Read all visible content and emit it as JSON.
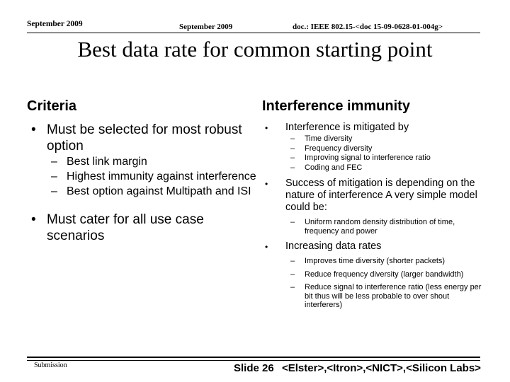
{
  "header": {
    "date_outer": "September 2009",
    "date_inner": "September 2009",
    "doc_reference": "doc.: IEEE 802.15-<doc 15-09-0628-01-004g>"
  },
  "title": "Best data rate for common starting point",
  "bullet_glyph": "•",
  "dash_glyph": "–",
  "columns": {
    "left": {
      "heading": "Criteria",
      "items": [
        {
          "level": 1,
          "text": "Must be selected for most robust option"
        },
        {
          "level": 2,
          "text": "Best link margin"
        },
        {
          "level": 2,
          "text": "Highest immunity against interference"
        },
        {
          "level": 2,
          "text": "Best option against Multipath and ISI"
        },
        {
          "level": 1,
          "text": "Must cater for all use case scenarios"
        }
      ]
    },
    "right": {
      "heading": "Interference immunity",
      "items": [
        {
          "level": 1,
          "text": "Interference is mitigated by"
        },
        {
          "level": 2,
          "text": "Time diversity"
        },
        {
          "level": 2,
          "text": "Frequency diversity"
        },
        {
          "level": 2,
          "text": "Improving signal to interference ratio"
        },
        {
          "level": 2,
          "text": "Coding and FEC"
        },
        {
          "level": 1,
          "text": "Success of mitigation is depending on the nature of interference A very simple model could be:"
        },
        {
          "level": 2,
          "text": "Uniform random density distribution of time, frequency and power"
        },
        {
          "level": 1,
          "text": "Increasing data rates"
        },
        {
          "level": 2,
          "text": "Improves time diversity (shorter packets)"
        },
        {
          "level": 2,
          "text": "Reduce frequency diversity (larger bandwidth)"
        },
        {
          "level": 2,
          "text": "Reduce signal to interference ratio (less energy per bit  thus will be less probable to over shout interferers)"
        }
      ]
    }
  },
  "footer": {
    "submission": "Submission",
    "slide_number": "Slide 26",
    "authors": "<Elster>,<Itron>,<NICT>,<Silicon Labs>"
  },
  "colors": {
    "background": "#ffffff",
    "text": "#000000",
    "rule": "#000000"
  }
}
